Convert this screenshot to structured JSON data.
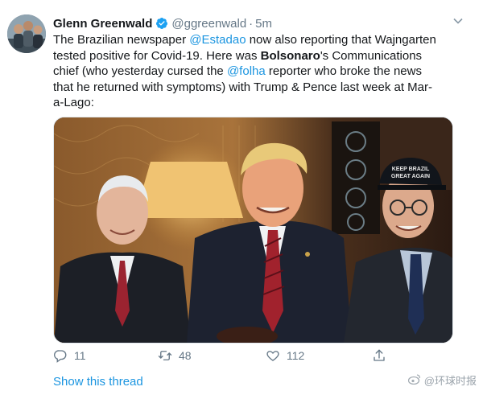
{
  "tweet": {
    "author": {
      "display_name": "Glenn Greenwald",
      "handle": "@ggreenwald",
      "time": "5m"
    },
    "text": {
      "p1": "The Brazilian newspaper ",
      "mention1": "@Estadao",
      "p2": " now also reporting that Wajngarten tested positive for Covid-19. Here was ",
      "bold1": "Bolsonaro",
      "p3": "'s Communications chief (who yesterday cursed the ",
      "mention2": "@folha",
      "p4": " reporter who broke the news that he returned with symptoms) with Trump & Pence last week at Mar-a-Lago:"
    },
    "photo": {
      "hat_text_line1": "KEEP BRAZIL",
      "hat_text_line2": "GREAT AGAIN"
    },
    "actions": {
      "reply_count": "11",
      "retweet_count": "48",
      "like_count": "112"
    },
    "show_thread_label": "Show this thread",
    "watermark": "@环球时报"
  },
  "colors": {
    "link": "#1b95e0",
    "secondary_text": "#657786",
    "verified": "#1da1f2"
  },
  "icons": [
    "verified-badge-icon",
    "chevron-down-icon",
    "reply-icon",
    "retweet-icon",
    "like-icon",
    "share-icon",
    "weibo-icon"
  ]
}
